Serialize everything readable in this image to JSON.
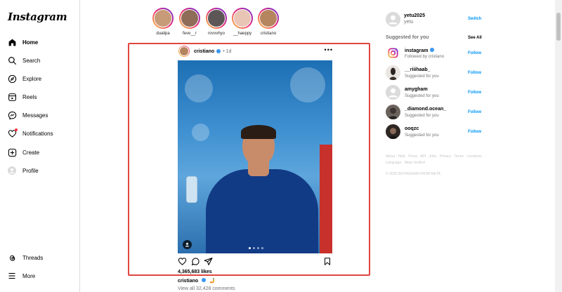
{
  "sidebar": {
    "logo": "Instagram",
    "items": [
      {
        "label": "Home",
        "icon": "home-icon"
      },
      {
        "label": "Search",
        "icon": "search-icon"
      },
      {
        "label": "Explore",
        "icon": "compass-icon"
      },
      {
        "label": "Reels",
        "icon": "reels-icon"
      },
      {
        "label": "Messages",
        "icon": "messenger-icon"
      },
      {
        "label": "Notifications",
        "icon": "heart-icon"
      },
      {
        "label": "Create",
        "icon": "plus-square-icon"
      },
      {
        "label": "Profile",
        "icon": "avatar-icon"
      }
    ],
    "threads_label": "Threads",
    "more_label": "More"
  },
  "stories": [
    "dualipa",
    "feve__r",
    "rovvvhyo",
    "__haeppy",
    "cristiano"
  ],
  "post": {
    "username": "cristiano",
    "time": "1d",
    "likes": "4,365,683 likes",
    "caption_user": "cristiano",
    "caption_text": "🤳",
    "comments_link": "View all 32,428 comments"
  },
  "me": {
    "username": "yetu2025",
    "fullname": "yetu",
    "switch_label": "Switch"
  },
  "suggested": {
    "title": "Suggested for you",
    "see_all": "See All",
    "follow_label": "Follow",
    "items": [
      {
        "name": "instagram",
        "sub": "Followed by cristiano",
        "verified": true
      },
      {
        "name": "__riiihaab_",
        "sub": "Suggested for you",
        "verified": false
      },
      {
        "name": "amygham",
        "sub": "Suggested for you",
        "verified": false
      },
      {
        "name": "_diamond.ocean_",
        "sub": "Suggested for you",
        "verified": false
      },
      {
        "name": "ooqzc",
        "sub": "Suggested for you",
        "verified": false
      }
    ]
  },
  "footer": {
    "links": "About · Help · Press · API · Jobs · Privacy · Terms · Locations · Language · Meta Verified",
    "copyright": "© 2025 INSTAGRAM FROM META"
  },
  "colors": {
    "accent": "#0095f6",
    "highlight_frame": "#e0463f",
    "verified": "#3897f0"
  }
}
